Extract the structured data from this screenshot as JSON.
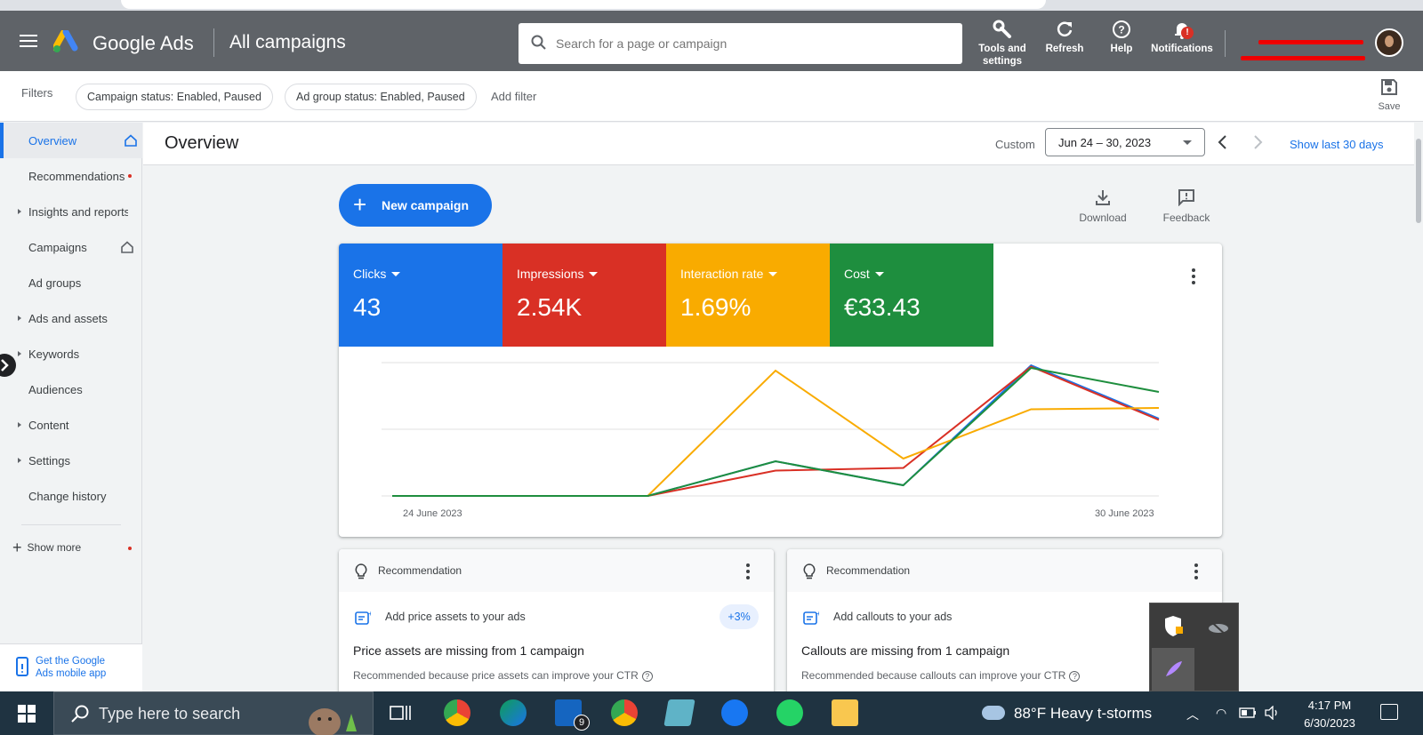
{
  "app": {
    "brand": "Google Ads",
    "title": "All campaigns"
  },
  "search": {
    "placeholder": "Search for a page or campaign"
  },
  "toolbar": {
    "tools_label": "Tools and settings",
    "refresh_label": "Refresh",
    "help_label": "Help",
    "notifications_label": "Notifications",
    "notifications_badge": "!"
  },
  "filters": {
    "label": "Filters",
    "chips": [
      "Campaign status: Enabled, Paused",
      "Ad group status: Enabled, Paused"
    ],
    "add_filter": "Add filter",
    "save_label": "Save"
  },
  "sidebar": {
    "items": [
      {
        "label": "Overview"
      },
      {
        "label": "Recommendations"
      },
      {
        "label": "Insights and reports"
      },
      {
        "label": "Campaigns"
      },
      {
        "label": "Ad groups"
      },
      {
        "label": "Ads and assets"
      },
      {
        "label": "Keywords"
      },
      {
        "label": "Audiences"
      },
      {
        "label": "Content"
      },
      {
        "label": "Settings"
      },
      {
        "label": "Change history"
      }
    ],
    "show_more": "Show more",
    "mobile_app": "Get the Google Ads mobile app"
  },
  "subheader": {
    "title": "Overview",
    "custom_label": "Custom",
    "date_range": "Jun 24 – 30, 2023",
    "show_last": "Show last 30 days"
  },
  "actions": {
    "new_campaign": "New campaign",
    "download": "Download",
    "feedback": "Feedback"
  },
  "metrics": [
    {
      "label": "Clicks",
      "value": "43",
      "color": "#1a73e8"
    },
    {
      "label": "Impressions",
      "value": "2.54K",
      "color": "#d93025"
    },
    {
      "label": "Interaction rate",
      "value": "1.69%",
      "color": "#f9ab00"
    },
    {
      "label": "Cost",
      "value": "€33.43",
      "color": "#1e8e3e"
    }
  ],
  "chart_data": {
    "type": "line",
    "x": [
      "24 June 2023",
      "25 June 2023",
      "26 June 2023",
      "27 June 2023",
      "28 June 2023",
      "29 June 2023",
      "30 June 2023"
    ],
    "x_tick_labels": [
      "24 June 2023",
      "30 June 2023"
    ],
    "normalized": true,
    "ylim": [
      0,
      1
    ],
    "grid": true,
    "series": [
      {
        "color": "#1a73e8",
        "values": [
          0,
          0,
          0,
          0.26,
          0.08,
          0.98,
          0.58
        ]
      },
      {
        "color": "#d93025",
        "values": [
          0,
          0,
          0,
          0.19,
          0.21,
          0.97,
          0.57
        ]
      },
      {
        "color": "#f9ab00",
        "values": [
          0,
          0,
          0,
          0.94,
          0.28,
          0.65,
          0.66
        ]
      },
      {
        "color": "#1e8e3e",
        "values": [
          0,
          0,
          0,
          0.26,
          0.08,
          0.96,
          0.78
        ]
      }
    ]
  },
  "recommendations": [
    {
      "header": "Recommendation",
      "title": "Add price assets to your ads",
      "badge": "+3%",
      "headline": "Price assets are missing from 1 campaign",
      "sub": "Recommended because price assets can improve your CTR"
    },
    {
      "header": "Recommendation",
      "title": "Add callouts to your ads",
      "badge": "",
      "headline": "Callouts are missing from 1 campaign",
      "sub": "Recommended because callouts can improve your CTR"
    }
  ],
  "taskbar": {
    "search_placeholder": "Type here to search",
    "mail_badge": "9",
    "weather": "88°F  Heavy t-storms",
    "time": "4:17 PM",
    "date": "6/30/2023"
  }
}
